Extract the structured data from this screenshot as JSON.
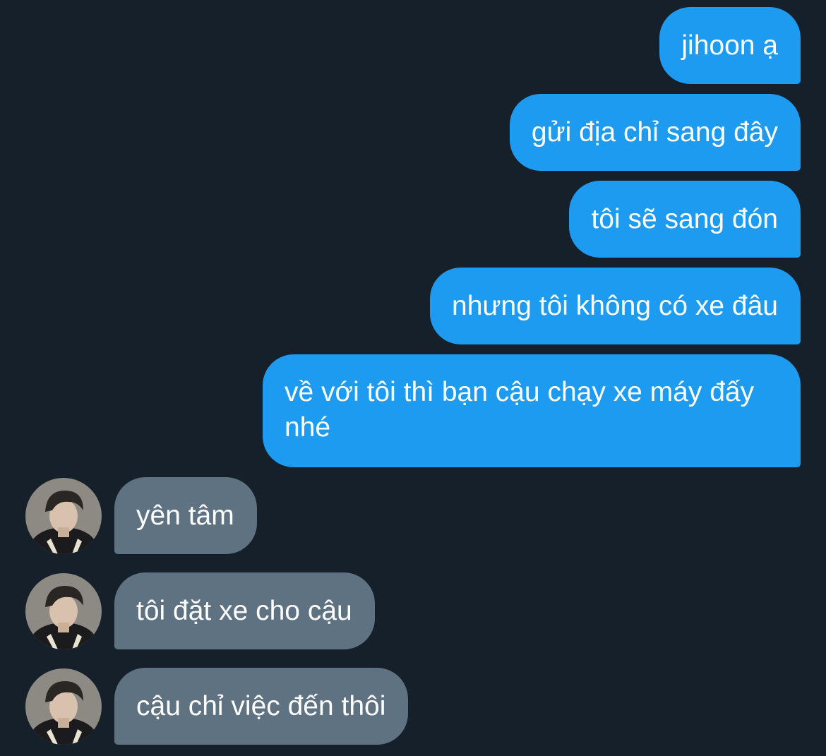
{
  "conversation": {
    "sent_messages": [
      {
        "text": "jihoon ạ"
      },
      {
        "text": "gửi địa chỉ sang đây"
      },
      {
        "text": "tôi sẽ sang đón"
      },
      {
        "text": "nhưng tôi không có xe đâu"
      },
      {
        "text": "về với tôi thì bạn cậu chạy xe máy đấy nhé"
      }
    ],
    "received_messages": [
      {
        "text": "yên tâm"
      },
      {
        "text": "tôi đặt xe cho cậu"
      },
      {
        "text": "cậu chỉ việc đến thôi"
      }
    ]
  },
  "colors": {
    "background": "#16202b",
    "sent_bubble": "#1d9bf0",
    "received_bubble": "#5f7282",
    "text": "#ffffff"
  },
  "icons": {
    "avatar": "contact-avatar-photo"
  }
}
